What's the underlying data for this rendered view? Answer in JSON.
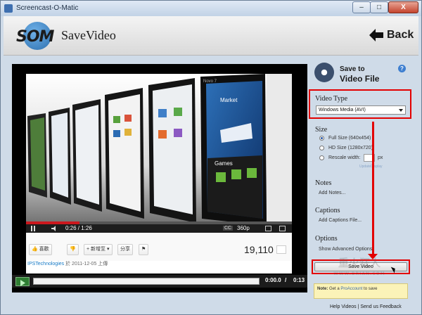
{
  "window": {
    "title": "Screencast-O-Matic",
    "close_label": "X"
  },
  "header": {
    "logo_text": "SOM",
    "page_title": "SaveVideo",
    "back_label": "Back"
  },
  "video": {
    "time": "0:26 / 1:26",
    "progress_fraction": 0.2,
    "quality": "360p",
    "cc_label": "CC",
    "buttons": [
      "喜歡",
      "新增至",
      "分享"
    ],
    "views": "19,110",
    "uploader_channel": "IPSTechnologies",
    "uploader_rest": " 於 2011-12-05 上傳",
    "screen_labels": [
      "Market",
      "Games",
      "Novo 7"
    ]
  },
  "playback": {
    "current_time": "0:00.0",
    "separator": " / ",
    "total_time": "0:13"
  },
  "side": {
    "save_to": "Save to",
    "video_file": "Video File",
    "help_label": "?",
    "video_type_heading": "Video Type",
    "video_type_value": "Windows Media (AVI)",
    "size_heading": "Size",
    "size_options": [
      {
        "label": "Full Size (640x454)",
        "selected": true
      },
      {
        "label": "HD Size (1280x720)",
        "selected": false
      },
      {
        "label": "Rescale width:",
        "selected": false
      }
    ],
    "width_unit": "px",
    "update_link": "UpdateDisplay",
    "notes_heading": "Notes",
    "notes_link": "Add Notes...",
    "captions_heading": "Captions",
    "captions_link": "Add Captions File...",
    "options_heading": "Options",
    "options_link": "Show Advanced Options",
    "save_button": "Save Video",
    "note_label": "Note:",
    "note_text": " Get a ",
    "note_link": "ProAccount",
    "note_tail": " to save"
  },
  "footer": {
    "help_videos": "Help Videos",
    "separator": " | ",
    "send_feedback": "Send us Feedback"
  },
  "watermark": {
    "main": "重火狂人",
    "url": "WWW.BRIAN.COM"
  },
  "colors": {
    "highlight": "#e30000",
    "accent": "#3e7fd0"
  }
}
